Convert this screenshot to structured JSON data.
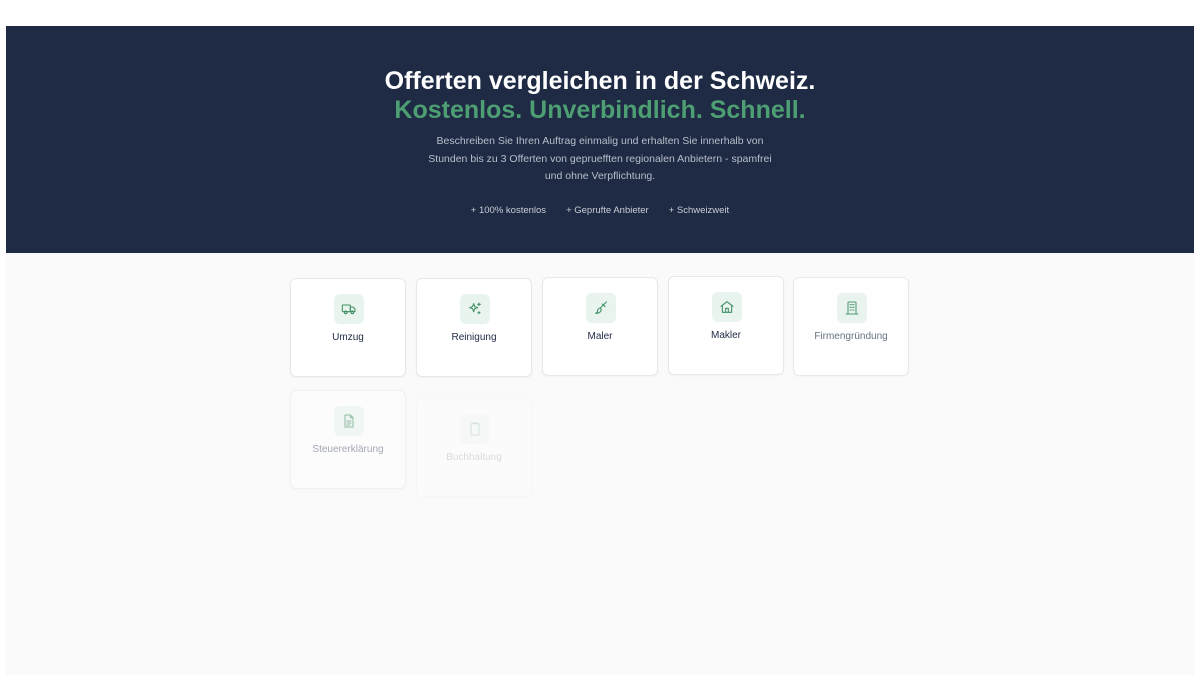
{
  "hero": {
    "title_line1": "Offerten vergleichen in der Schweiz.",
    "title_line2": "Kostenlos. Unverbindlich. Schnell.",
    "description": "Beschreiben Sie Ihren Auftrag einmalig und erhalten Sie innerhalb von Stunden bis zu 3 Offerten von gepruefften regionalen Anbietern - spamfrei und ohne Verpflichtung.",
    "features": [
      "+ 100% kostenlos",
      "+ Geprufte Anbieter",
      "+ Schweizweit"
    ]
  },
  "services": [
    {
      "label": "Umzug",
      "icon": "truck-icon"
    },
    {
      "label": "Reinigung",
      "icon": "sparkles-icon"
    },
    {
      "label": "Maler",
      "icon": "paintbrush-icon"
    },
    {
      "label": "Makler",
      "icon": "house-icon"
    },
    {
      "label": "Firmengründung",
      "icon": "building-icon"
    },
    {
      "label": "Steuererklärung",
      "icon": "document-icon"
    },
    {
      "label": "Buchhaltung",
      "icon": "clipboard-icon"
    }
  ],
  "colors": {
    "hero_bg": "#1f2a44",
    "accent_green": "#4d9e72",
    "page_bg": "#fafafa"
  }
}
